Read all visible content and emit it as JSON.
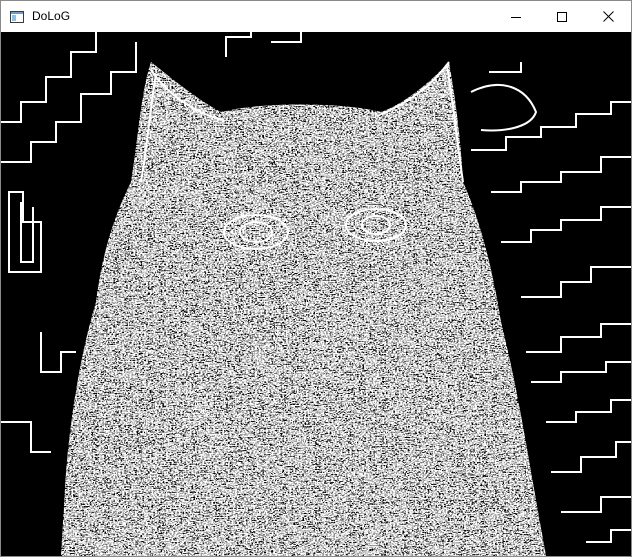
{
  "window": {
    "title": "DoLoG",
    "app_icon": "window-app-icon",
    "controls": {
      "minimize_icon": "minimize-icon",
      "maximize_icon": "maximize-icon",
      "close_icon": "close-icon"
    }
  },
  "image": {
    "icon": "edge-detection-output-image",
    "background_color": "#000000",
    "edge_color": "#ffffff"
  }
}
